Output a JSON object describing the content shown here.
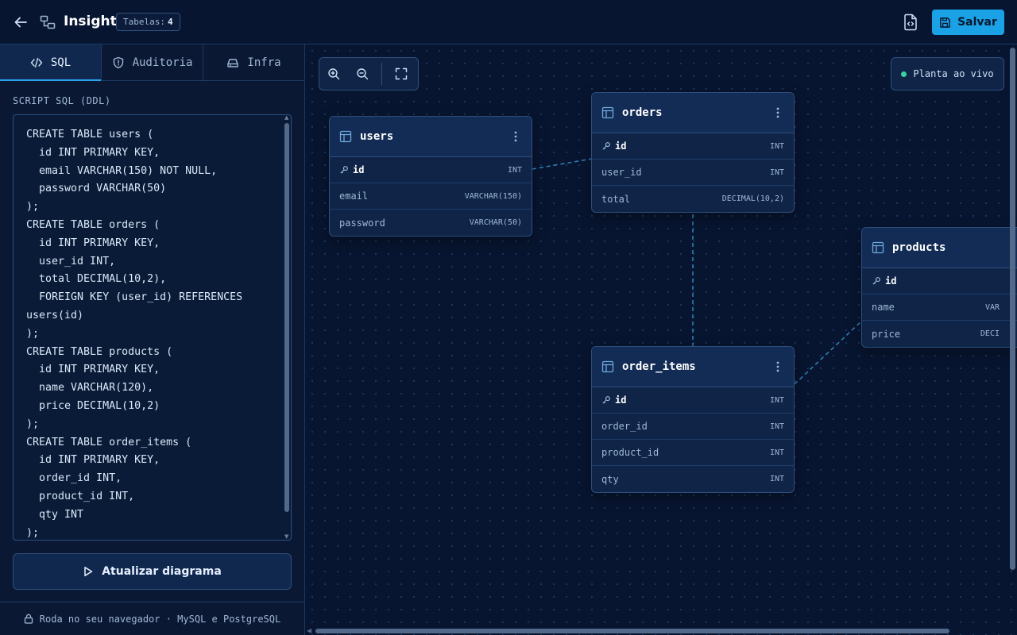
{
  "header": {
    "title": "Insight",
    "tables_label": "Tabelas:",
    "tables_count": "4",
    "save_label": "Salvar"
  },
  "sidebar": {
    "tabs": [
      {
        "label": "SQL",
        "icon": "code-icon",
        "active": true
      },
      {
        "label": "Auditoria",
        "icon": "shield-icon",
        "active": false
      },
      {
        "label": "Infra",
        "icon": "server-icon",
        "active": false
      }
    ],
    "script_label": "SCRIPT SQL (DDL)",
    "script": "CREATE TABLE users (\n  id INT PRIMARY KEY,\n  email VARCHAR(150) NOT NULL,\n  password VARCHAR(50)\n);\nCREATE TABLE orders (\n  id INT PRIMARY KEY,\n  user_id INT,\n  total DECIMAL(10,2),\n  FOREIGN KEY (user_id) REFERENCES users(id)\n);\nCREATE TABLE products (\n  id INT PRIMARY KEY,\n  name VARCHAR(120),\n  price DECIMAL(10,2)\n);\nCREATE TABLE order_items (\n  id INT PRIMARY KEY,\n  order_id INT,\n  product_id INT,\n  qty INT\n);",
    "update_label": "Atualizar diagrama",
    "footer_text": "Roda no seu navegador · MySQL e PostgreSQL"
  },
  "canvas": {
    "live_label": "Planta ao vivo",
    "tables": [
      {
        "name": "users",
        "columns": [
          {
            "name": "id",
            "type": "INT",
            "pk": true
          },
          {
            "name": "email",
            "type": "VARCHAR(150)",
            "pk": false
          },
          {
            "name": "password",
            "type": "VARCHAR(50)",
            "pk": false
          }
        ]
      },
      {
        "name": "orders",
        "columns": [
          {
            "name": "id",
            "type": "INT",
            "pk": true
          },
          {
            "name": "user_id",
            "type": "INT",
            "pk": false
          },
          {
            "name": "total",
            "type": "DECIMAL(10,2)",
            "pk": false
          }
        ]
      },
      {
        "name": "products",
        "columns": [
          {
            "name": "id",
            "type": "",
            "pk": true
          },
          {
            "name": "name",
            "type": "VAR",
            "pk": false
          },
          {
            "name": "price",
            "type": "DECI",
            "pk": false
          }
        ]
      },
      {
        "name": "order_items",
        "columns": [
          {
            "name": "id",
            "type": "INT",
            "pk": true
          },
          {
            "name": "order_id",
            "type": "INT",
            "pk": false
          },
          {
            "name": "product_id",
            "type": "INT",
            "pk": false
          },
          {
            "name": "qty",
            "type": "INT",
            "pk": false
          }
        ]
      }
    ]
  },
  "colors": {
    "accent": "#1ba1e6",
    "background": "#081530",
    "panel": "#0f2447",
    "border": "#2d4f7c",
    "live": "#3ad29f"
  }
}
